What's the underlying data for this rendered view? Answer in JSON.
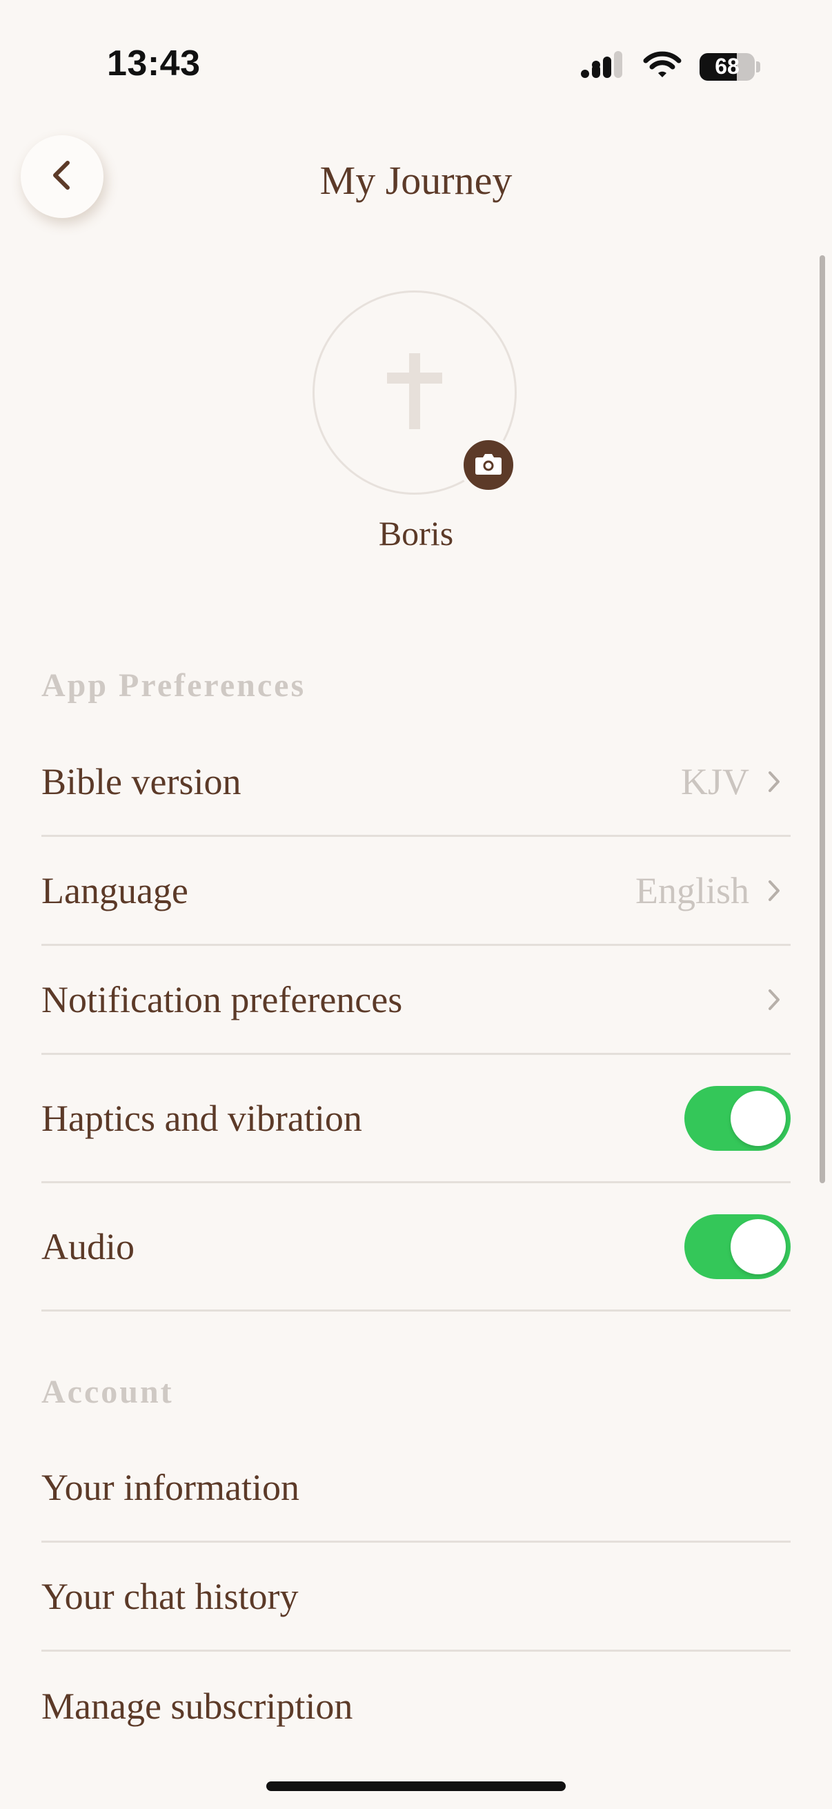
{
  "status_bar": {
    "time": "13:43",
    "battery_percent": "68",
    "battery_level": 0.68
  },
  "header": {
    "title": "My Journey"
  },
  "profile": {
    "name": "Boris"
  },
  "sections": {
    "app_preferences": {
      "title": "App Preferences",
      "bible_version": {
        "label": "Bible version",
        "value": "KJV"
      },
      "language": {
        "label": "Language",
        "value": "English"
      },
      "notifications": {
        "label": "Notification preferences"
      },
      "haptics": {
        "label": "Haptics and vibration",
        "enabled": true
      },
      "audio": {
        "label": "Audio",
        "enabled": true
      }
    },
    "account": {
      "title": "Account",
      "your_information": {
        "label": "Your information"
      },
      "chat_history": {
        "label": "Your chat history"
      },
      "manage_subscription": {
        "label": "Manage subscription"
      }
    }
  },
  "colors": {
    "background": "#faf7f4",
    "text_primary": "#5c3a28",
    "text_muted": "#cbc5c0",
    "toggle_on": "#34c759",
    "divider": "#e4dfda"
  }
}
